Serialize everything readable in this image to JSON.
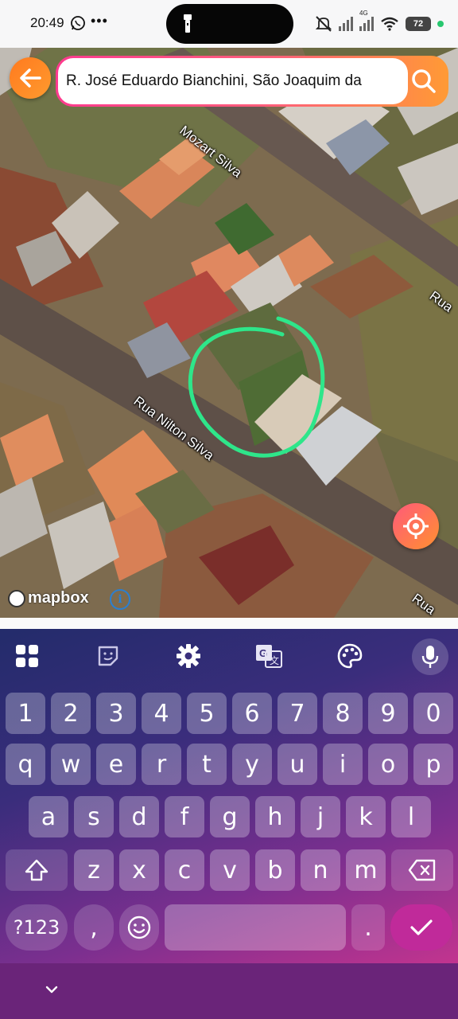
{
  "status_bar": {
    "time": "20:49",
    "more": "•••",
    "network": "4G",
    "battery": "72"
  },
  "search": {
    "query": "R. José Eduardo Bianchini, São Joaquim da"
  },
  "map": {
    "street_labels": [
      {
        "text": "Mozart Silva"
      },
      {
        "text": "Rua Nilton Silva"
      },
      {
        "text": "Rua"
      },
      {
        "text": "Rua"
      }
    ],
    "attribution": "mapbox",
    "info": "i",
    "highlight_color": "#2ee68a"
  },
  "keyboard": {
    "rows": [
      [
        "1",
        "2",
        "3",
        "4",
        "5",
        "6",
        "7",
        "8",
        "9",
        "0"
      ],
      [
        "q",
        "w",
        "e",
        "r",
        "t",
        "y",
        "u",
        "i",
        "o",
        "p"
      ],
      [
        "a",
        "s",
        "d",
        "f",
        "g",
        "h",
        "j",
        "k",
        "l"
      ],
      [
        "z",
        "x",
        "c",
        "v",
        "b",
        "n",
        "m"
      ]
    ],
    "symbols_key": "?123",
    "comma_key": ",",
    "period_key": ".",
    "accent_color": "#c02a9a"
  }
}
